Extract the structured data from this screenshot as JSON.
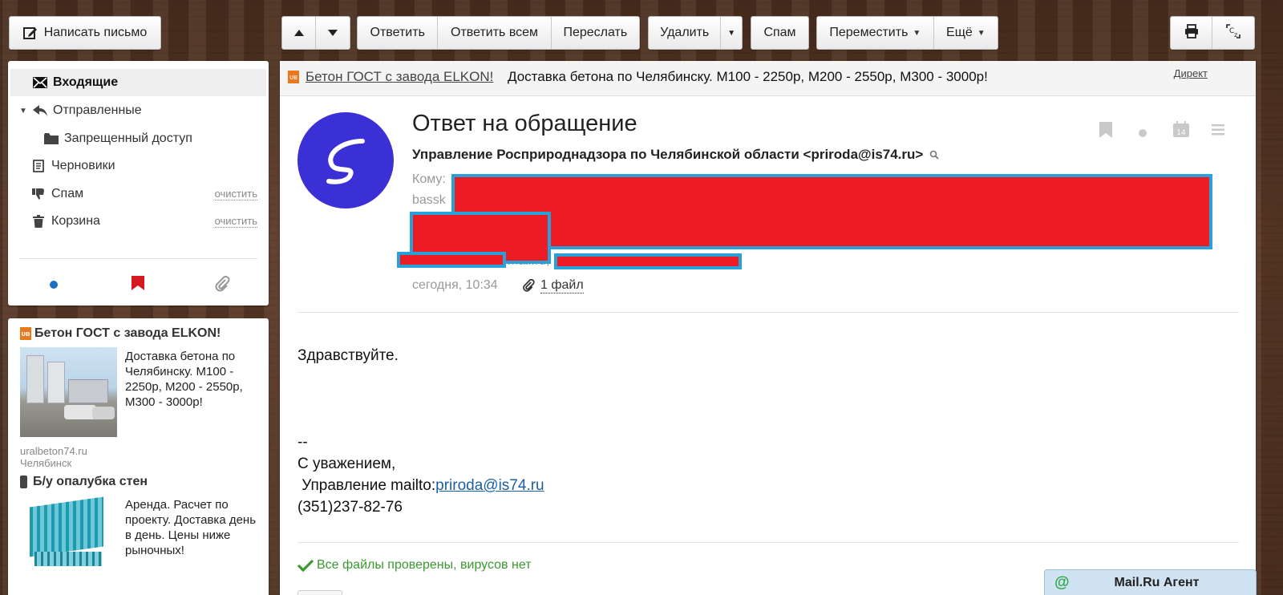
{
  "toolbar": {
    "compose_label": "Написать письмо",
    "reply_label": "Ответить",
    "reply_all_label": "Ответить всем",
    "forward_label": "Переслать",
    "delete_label": "Удалить",
    "spam_label": "Спам",
    "move_label": "Переместить",
    "more_label": "Ещё"
  },
  "sidebar": {
    "folders": [
      {
        "label": "Входящие",
        "icon": "envelope-icon",
        "active": true
      },
      {
        "label": "Отправленные",
        "icon": "reply-arrow-icon"
      },
      {
        "label": "Запрещенный доступ",
        "icon": "folder-icon"
      },
      {
        "label": "Черновики",
        "icon": "draft-icon"
      },
      {
        "label": "Спам",
        "icon": "thumbs-down-icon",
        "action": "очистить"
      },
      {
        "label": "Корзина",
        "icon": "trash-icon",
        "action": "очистить"
      }
    ],
    "filters": [
      "unread-dot-icon",
      "bookmark-icon",
      "paperclip-icon"
    ]
  },
  "ads": {
    "ad1": {
      "title": "Бетон ГОСТ с завода ELKON!",
      "text": "Доставка бетона по Челябинску. М100 - 2250р, М200 - 2550р, М300 - 3000р!",
      "domain": "uralbeton74.ru",
      "city": "Челябинск"
    },
    "ad2": {
      "title": "Б/у опалубка стен",
      "text": "Аренда. Расчет по проекту. Доставка день в день. Цены ниже рыночных!"
    }
  },
  "banner": {
    "link": "Бетон ГОСТ с завода ELKON!",
    "text": "Доставка бетона по Челябинску. М100 - 2250р, М200 - 2550р, М300 - 3000р!",
    "direct": "Директ"
  },
  "message": {
    "subject": "Ответ на обращение",
    "from": "Управление Росприроднадзора по Челябинской области <priroda@is74.ru>",
    "to_label": "Кому:",
    "to_fragment": "bassk",
    "to_fragment2": "mail.ru,",
    "date": "сегодня, 10:34",
    "attachments": "1 файл",
    "body": {
      "greeting": "Здравствуйте.",
      "sig_sep": "--",
      "sig_regards": "С уважением,",
      "sig_org_prefix": " Управление mailto:",
      "sig_email": "priroda@is74.ru",
      "sig_phone": "(351)237-82-76"
    },
    "virus_check": "Все файлы проверены, вирусов нет"
  },
  "agent": {
    "label": "Mail.Ru Агент"
  },
  "colors": {
    "accent_blue": "#1a5fa8",
    "avatar_bg": "#3b2fd6",
    "ok_green": "#3a9a2f",
    "redaction": "#ed1c24"
  }
}
